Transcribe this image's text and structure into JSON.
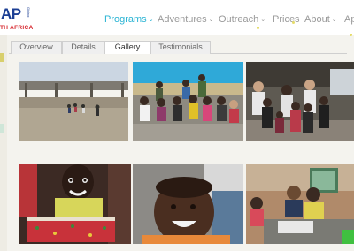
{
  "logo": {
    "main_prefix": "",
    "main_blue": "AP",
    "vertical_text": "Giving",
    "subtitle": "TH AFRICA"
  },
  "nav": {
    "items": [
      {
        "label": "Programs",
        "active": true,
        "has_dropdown": true
      },
      {
        "label": "Adventures",
        "active": false,
        "has_dropdown": true
      },
      {
        "label": "Outreach",
        "active": false,
        "has_dropdown": true
      },
      {
        "label": "Prices",
        "active": false,
        "has_dropdown": false
      },
      {
        "label": "About",
        "active": false,
        "has_dropdown": true
      },
      {
        "label": "Ap",
        "active": false,
        "has_dropdown": false
      }
    ],
    "caret": "⌄"
  },
  "tabs": [
    {
      "label": "Overview",
      "active": false
    },
    {
      "label": "Details",
      "active": false
    },
    {
      "label": "Gallery",
      "active": true
    },
    {
      "label": "Testimonials",
      "active": false
    }
  ],
  "gallery": {
    "photos": [
      {
        "subject": "flooded-courtyard-children"
      },
      {
        "subject": "group-photo-volunteers-children"
      },
      {
        "subject": "group-photo-indoor"
      },
      {
        "subject": "child-with-gift-box"
      },
      {
        "subject": "smiling-child-closeup"
      },
      {
        "subject": "children-reading-table"
      }
    ]
  },
  "colors": {
    "nav_active": "#2ab4d4",
    "nav_default": "#9a9a9a",
    "logo_blue": "#1c3f94",
    "logo_red": "#d6232a",
    "background": "#f4f3ee"
  }
}
